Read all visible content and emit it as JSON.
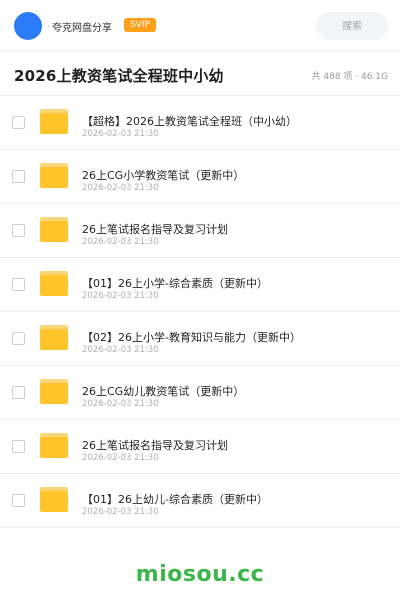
{
  "topbar": {
    "share_name": "夸克网盘分享",
    "badge": "SVIP",
    "search_placeholder": "搜索"
  },
  "header": {
    "title": "2026上教资笔试全程班中小幼",
    "summary": "共 488 项 · 46.1G"
  },
  "files": [
    {
      "name": "【超格】2026上教资笔试全程班（中小幼）",
      "date": "2026-02-03 21:30"
    },
    {
      "name": "26上CG小学教资笔试（更新中）",
      "date": "2026-02-03 21:30"
    },
    {
      "name": "26上笔试报名指导及复习计划",
      "date": "2026-02-03 21:30"
    },
    {
      "name": "【01】26上小学-综合素质（更新中）",
      "date": "2026-02-03 21:30"
    },
    {
      "name": "【02】26上小学-教育知识与能力（更新中）",
      "date": "2026-02-03 21:30"
    },
    {
      "name": "26上CG幼儿教资笔试（更新中）",
      "date": "2026-02-03 21:30"
    },
    {
      "name": "26上笔试报名指导及复习计划",
      "date": "2026-02-03 21:30"
    },
    {
      "name": "【01】26上幼儿-综合素质（更新中）",
      "date": "2026-02-03 21:30"
    }
  ],
  "watermark": "miosou.cc",
  "colors": {
    "accent_blue": "#2b7cf6",
    "svip_orange": "#ff9f1a",
    "folder_yellow": "#ffc52b",
    "watermark_green": "#3cb64a"
  },
  "icons": {
    "avatar": "user-avatar",
    "folder": "folder-icon"
  }
}
